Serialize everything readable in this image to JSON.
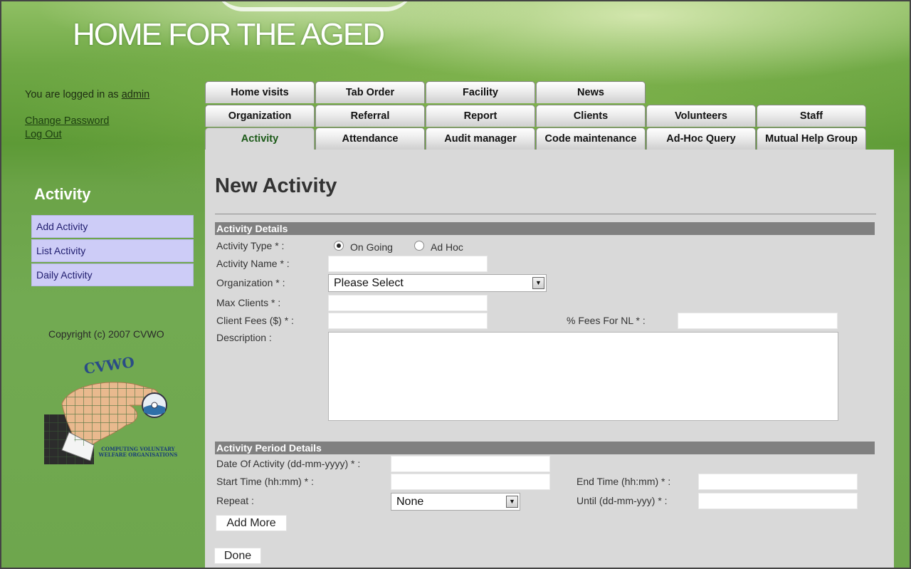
{
  "header": {
    "title": "HOME FOR THE AGED"
  },
  "sidebar": {
    "logged_in_prefix": "You are logged in as",
    "username": "admin",
    "change_password": "Change Password",
    "log_out": "Log Out",
    "section_title": "Activity",
    "items": [
      "Add Activity",
      "List Activity",
      "Daily Activity"
    ],
    "copyright": "Copyright (c) 2007 CVWO",
    "logo": {
      "name": "CVWO",
      "line1": "COMPUTING VOLUNTARY",
      "line2": "WELFARE ORGANISATIONS"
    }
  },
  "tabs": {
    "row1": [
      "Home visits",
      "Tab Order",
      "Facility",
      "News"
    ],
    "row2": [
      "Organization",
      "Referral",
      "Report",
      "Clients",
      "Volunteers",
      "Staff"
    ],
    "row3": [
      "Activity",
      "Attendance",
      "Audit manager",
      "Code maintenance",
      "Ad-Hoc Query",
      "Mutual Help Group"
    ],
    "active": "Activity"
  },
  "form": {
    "heading": "New Activity",
    "details_section": "Activity Details",
    "activity_type_label": "Activity Type * :",
    "activity_type_options": [
      "On Going",
      "Ad Hoc"
    ],
    "activity_type_selected": "On Going",
    "activity_name_label": "Activity Name * :",
    "activity_name_value": "",
    "organization_label": "Organization * :",
    "organization_value": "Please Select",
    "max_clients_label": "Max Clients * :",
    "max_clients_value": "",
    "client_fees_label": "Client Fees ($) * :",
    "client_fees_value": "",
    "fees_nl_label": "% Fees For NL * :",
    "fees_nl_value": "",
    "description_label": "Description :",
    "description_value": "",
    "period_section": "Activity Period Details",
    "date_label": "Date Of Activity (dd-mm-yyyy) * :",
    "date_value": "",
    "start_time_label": "Start Time (hh:mm) * :",
    "start_time_value": "",
    "end_time_label": "End Time (hh:mm) * :",
    "end_time_value": "",
    "repeat_label": "Repeat :",
    "repeat_value": "None",
    "until_label": "Until (dd-mm-yyy) * :",
    "until_value": "",
    "add_more_label": "Add More",
    "done_label": "Done"
  }
}
